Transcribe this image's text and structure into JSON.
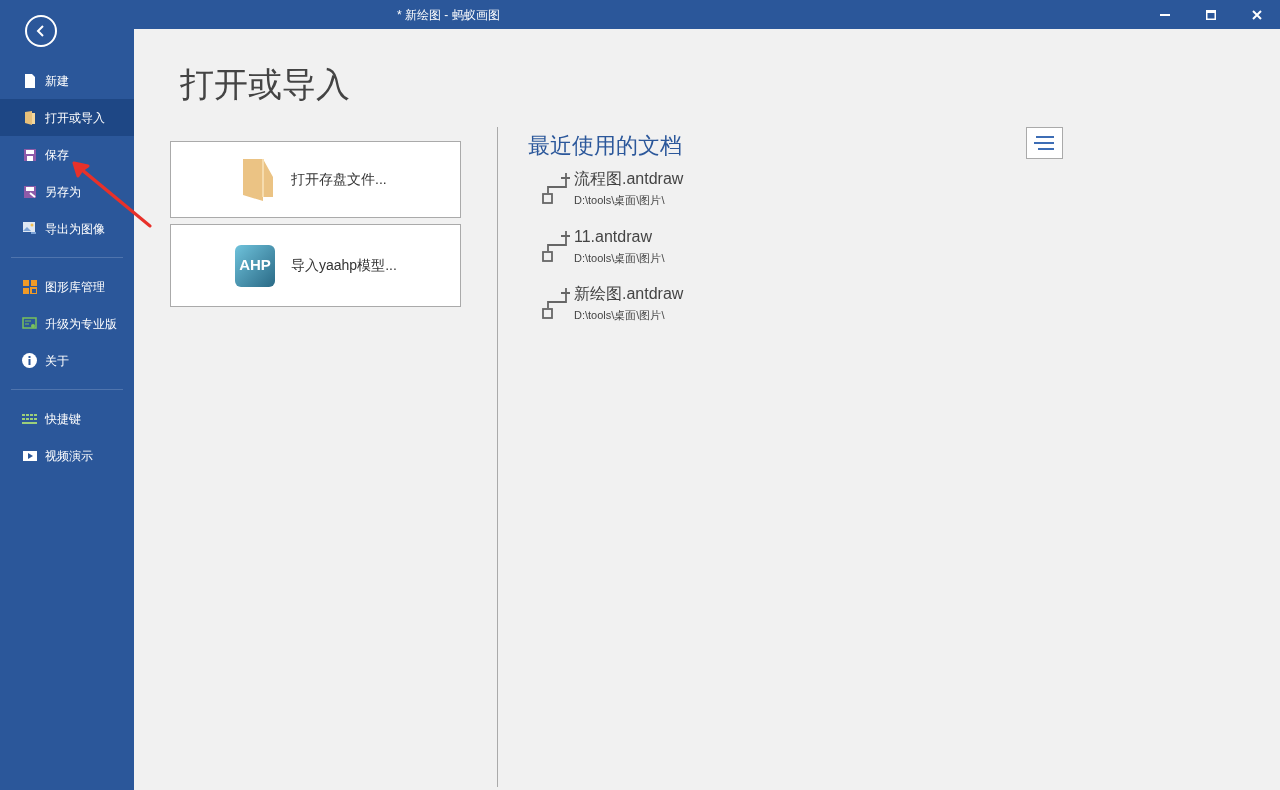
{
  "window": {
    "title": "* 新绘图 - 蚂蚁画图"
  },
  "sidebar": {
    "groups": [
      {
        "items": [
          {
            "label": "新建",
            "selected": false
          },
          {
            "label": "打开或导入",
            "selected": true
          },
          {
            "label": "保存",
            "selected": false
          },
          {
            "label": "另存为",
            "selected": false
          },
          {
            "label": "导出为图像",
            "selected": false
          }
        ]
      },
      {
        "items": [
          {
            "label": "图形库管理",
            "selected": false
          },
          {
            "label": "升级为专业版",
            "selected": false
          },
          {
            "label": "关于",
            "selected": false
          }
        ]
      },
      {
        "items": [
          {
            "label": "快捷键",
            "selected": false
          },
          {
            "label": "视频演示",
            "selected": false
          }
        ]
      }
    ]
  },
  "page_title": "打开或导入",
  "actions": [
    {
      "label": "打开存盘文件..."
    },
    {
      "label": "导入yaahp模型...",
      "logo_text": "AHP"
    }
  ],
  "recent": {
    "title": "最近使用的文档",
    "files": [
      {
        "name": "流程图.antdraw",
        "path": "D:\\tools\\桌面\\图片\\"
      },
      {
        "name": "11.antdraw",
        "path": "D:\\tools\\桌面\\图片\\"
      },
      {
        "name": "新绘图.antdraw",
        "path": "D:\\tools\\桌面\\图片\\"
      }
    ]
  }
}
